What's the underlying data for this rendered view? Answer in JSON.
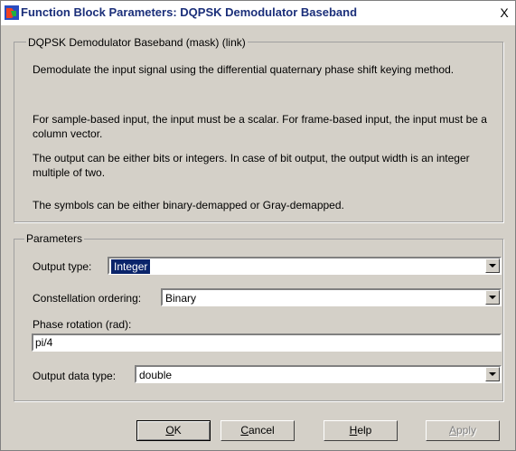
{
  "window": {
    "title": "Function Block Parameters: DQPSK Demodulator Baseband",
    "close_glyph": "X"
  },
  "description_group": {
    "legend": "DQPSK Demodulator Baseband (mask) (link)",
    "paragraphs": [
      "Demodulate the input signal using the differential quaternary phase shift keying method.",
      "For sample-based input, the input must be a scalar. For frame-based input, the input must be a column vector.",
      "The output can be either bits or integers. In case of bit output, the output width is an integer multiple of two.",
      "The symbols can be either binary-demapped or Gray-demapped."
    ]
  },
  "parameters_group": {
    "legend": "Parameters",
    "output_type": {
      "label": "Output type:",
      "value": "Integer"
    },
    "constellation_ordering": {
      "label": "Constellation ordering:",
      "value": "Binary"
    },
    "phase_rotation": {
      "label": "Phase rotation (rad):",
      "value": "pi/4"
    },
    "output_data_type": {
      "label": "Output data type:",
      "value": "double"
    }
  },
  "buttons": {
    "ok": {
      "mnemonic": "O",
      "rest": "K"
    },
    "cancel": {
      "mnemonic": "C",
      "rest": "ancel"
    },
    "help": {
      "mnemonic": "H",
      "rest": "elp"
    },
    "apply": {
      "mnemonic": "A",
      "rest": "pply"
    }
  },
  "icons": {
    "app": "simulink-block-icon",
    "dropdown": "chevron-down-icon"
  }
}
